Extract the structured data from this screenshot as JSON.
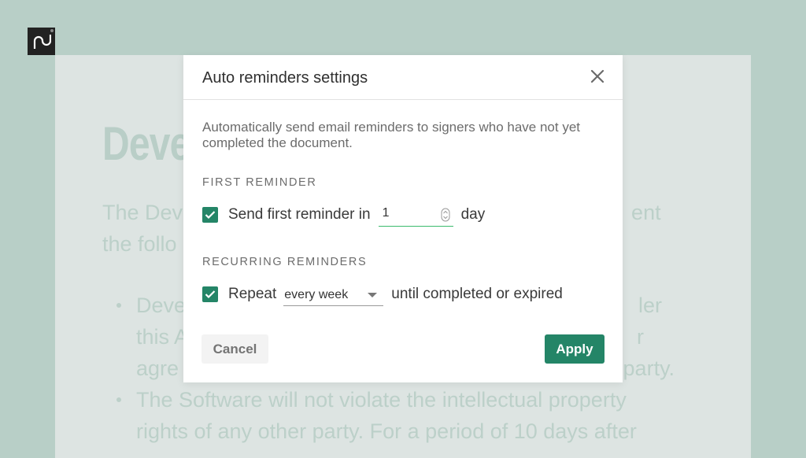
{
  "brand": {
    "logo_text": "pd",
    "logo_icon": "pandadoc-logo"
  },
  "background_document": {
    "title": "Deve",
    "paragraph": "The Developer represents and warrants to the Client that the following:",
    "paragraph_visible_left": "The Dev",
    "paragraph_visible_left_2": "the follo",
    "paragraph_visible_right": "ent",
    "bullets": [
      {
        "line1_left": "Deve",
        "line1_right": "ler",
        "line2_left": "this A",
        "line2_right": "r",
        "line3_left": "agre",
        "line3_right": "r party."
      },
      {
        "line1": "The Software will not violate the intellectual property",
        "line2": "rights of any other party. For a period of 10 days after"
      }
    ]
  },
  "modal": {
    "title": "Auto reminders settings",
    "close_icon": "close-icon",
    "description": "Automatically send email reminders to signers who have not yet completed the document.",
    "first_reminder": {
      "section_label": "FIRST REMINDER",
      "checked": true,
      "label": "Send first reminder in",
      "value": "1",
      "unit": "day"
    },
    "recurring_reminders": {
      "section_label": "RECURRING REMINDERS",
      "checked": true,
      "label": "Repeat",
      "frequency": "every week",
      "suffix": "until completed or expired"
    },
    "buttons": {
      "cancel": "Cancel",
      "apply": "Apply"
    }
  },
  "colors": {
    "accent": "#248567",
    "input_focus": "#3bbb6d",
    "backdrop": "#b8cfc7"
  }
}
